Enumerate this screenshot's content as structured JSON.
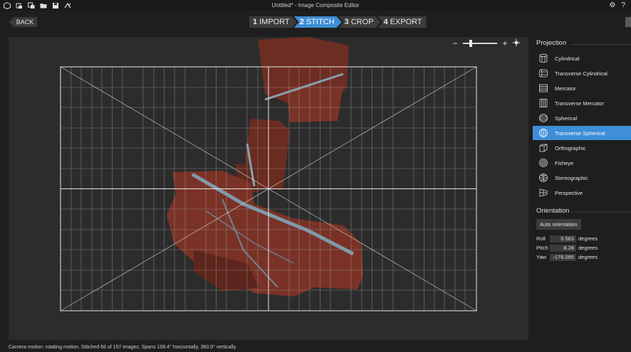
{
  "window": {
    "title": "Untitled* - Image Composite Editor"
  },
  "toolbar": {
    "back_label": "BACK"
  },
  "steps": [
    {
      "num": "1",
      "label": "IMPORT"
    },
    {
      "num": "2",
      "label": "STITCH"
    },
    {
      "num": "3",
      "label": "CROP"
    },
    {
      "num": "4",
      "label": "EXPORT"
    }
  ],
  "active_step": "STITCH",
  "zoom": {
    "minus": "−",
    "plus": "+",
    "level": 0.2
  },
  "projection": {
    "title": "Projection",
    "items": [
      {
        "label": "Cylindrical",
        "icon": "cylindrical-icon"
      },
      {
        "label": "Transverse Cylindrical",
        "icon": "transverse-cylindrical-icon"
      },
      {
        "label": "Mercator",
        "icon": "mercator-icon"
      },
      {
        "label": "Transverse Mercator",
        "icon": "transverse-mercator-icon"
      },
      {
        "label": "Spherical",
        "icon": "spherical-icon"
      },
      {
        "label": "Transverse Spherical",
        "icon": "transverse-spherical-icon"
      },
      {
        "label": "Orthographic",
        "icon": "orthographic-icon"
      },
      {
        "label": "Fisheye",
        "icon": "fisheye-icon"
      },
      {
        "label": "Stereographic",
        "icon": "stereographic-icon"
      },
      {
        "label": "Perspective",
        "icon": "perspective-icon"
      }
    ],
    "selected": "Transverse Spherical"
  },
  "orientation": {
    "title": "Orientation",
    "auto_label": "Auto orientation",
    "unit": "degrees",
    "roll_label": "Roll",
    "roll": "0.563",
    "pitch_label": "Pitch",
    "pitch": "8.28",
    "yaw_label": "Yaw",
    "yaw": "-176.095"
  },
  "status": "Camera motion: rotating motion. Stitched 66 of 157 images. Spans 108.4° horizontally, 360.0° vertically.",
  "colors": {
    "accent": "#3e8ed8",
    "canvas": "#2c2c2c",
    "photo": "#7a3226"
  }
}
